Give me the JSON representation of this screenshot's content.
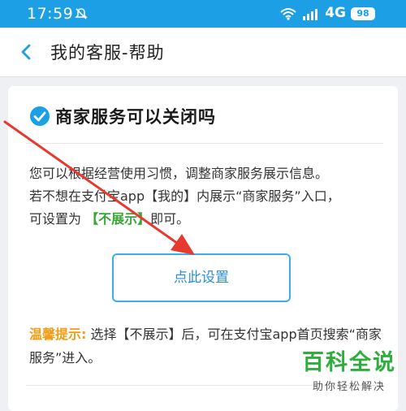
{
  "status": {
    "time": "17:59",
    "network": "4G",
    "battery": "98",
    "icons": [
      "mute-icon",
      "wifi-icon",
      "signal-icon"
    ]
  },
  "header": {
    "title": "我的客服-帮助",
    "back_icon": "chevron-left-icon"
  },
  "card": {
    "question": "商家服务可以关闭吗",
    "answer_line1": "您可以根据经营使用习惯，调整商家服务展示信息。",
    "answer_line2": "若不想在支付宝app【我的】内展示“商家服务”入口，",
    "answer_line3_pre": "可设置为 ",
    "answer_highlight": "【不展示】",
    "answer_line3_post": "即可。",
    "button_label": "点此设置",
    "tip_label": "温馨提示:",
    "tip_text": " 选择【不展示】后，可在支付宝app首页搜索“商家服务”进入。"
  },
  "watermark": {
    "logo": "百科全说",
    "sub": "助你轻松解决"
  },
  "colors": {
    "statusbar": "#1d9fe6",
    "accent_blue": "#3daee9",
    "highlight_green": "#3aa538",
    "tip_orange": "#f39c12",
    "annotation_red": "#e8392f"
  }
}
